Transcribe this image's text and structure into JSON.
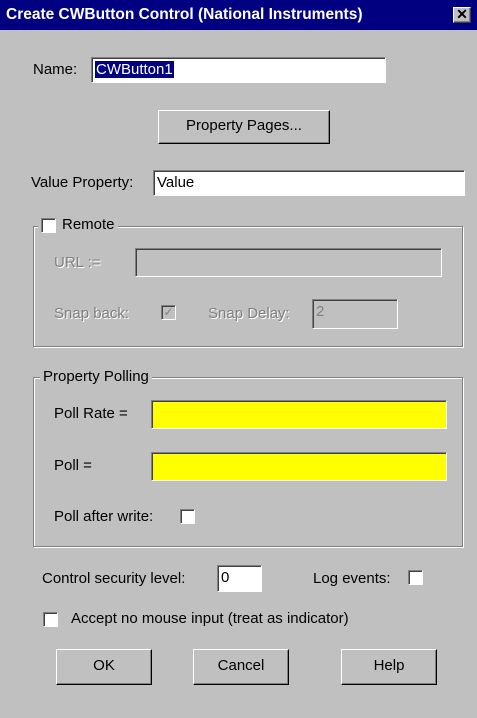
{
  "window": {
    "title": "Create CWButton Control  (National Instruments)",
    "close_glyph": "✕",
    "close_icon": "close-icon"
  },
  "name": {
    "label": "Name:",
    "value": "CWButton1"
  },
  "property_pages_label": "Property Pages...",
  "value_property": {
    "label": "Value Property:",
    "value": "Value"
  },
  "remote": {
    "label": "Remote",
    "checked": false,
    "url_label": "URL :=",
    "url_value": "",
    "snap_back_label": "Snap back:",
    "snap_back_checked": true,
    "snap_back_glyph": "✓",
    "snap_delay_label": "Snap Delay:",
    "snap_delay_value": "2"
  },
  "polling": {
    "legend": "Property Polling",
    "poll_rate_label": "Poll Rate =",
    "poll_rate_value": "",
    "poll_label": "Poll =",
    "poll_value": "",
    "poll_after_write_label": "Poll after write:",
    "field_color": "#ffff00"
  },
  "security": {
    "label": "Control security level:",
    "value": "0"
  },
  "log_events_label": "Log events:",
  "accept_no_mouse_label": "Accept no mouse input (treat as indicator)",
  "buttons": {
    "ok": "OK",
    "cancel": "Cancel",
    "help": "Help"
  },
  "colors": {
    "titlebar": "#000080",
    "dialog": "#c0c0c0",
    "highlight": "#000080"
  }
}
